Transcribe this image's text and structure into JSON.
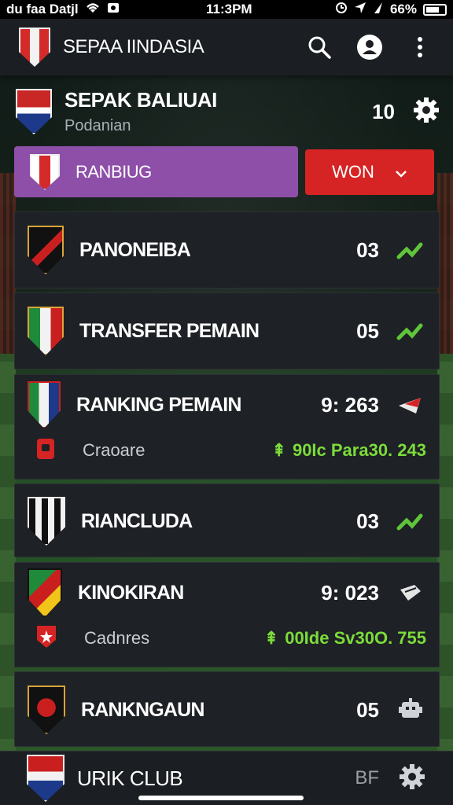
{
  "status_bar": {
    "carrier": "du faa Datjl",
    "time": "11:3PM",
    "battery": "66%"
  },
  "app_bar": {
    "title": "SEPAA IINDASIA",
    "icons": [
      "search-icon",
      "account-icon",
      "more-vert-icon"
    ]
  },
  "league": {
    "name": "SEPAK BALIUAI",
    "subtitle": "Podanian",
    "count": "10",
    "settings_icon": "gear-icon"
  },
  "filters": {
    "ranking_label": "RANBIUG",
    "won_label": "WON"
  },
  "cards": [
    {
      "title": "PANONEIBA",
      "value": "03",
      "trend": "up"
    },
    {
      "title": "TRANSFER PEMAIN",
      "value": "05",
      "trend": "up"
    },
    {
      "title": "RANKING PEMAIN",
      "value": "9: 263",
      "trend": "down",
      "sub": {
        "label": "Craoare",
        "value": "90Ic Para30.  243"
      }
    },
    {
      "title": "RIANCLUDA",
      "value": "03",
      "trend": "up"
    },
    {
      "title": "KINOKIRAN",
      "value": "9: 023",
      "trend": "flag",
      "sub": {
        "label": "Cadnres",
        "value": "00Ide Sv30O.  755"
      }
    },
    {
      "title": "RANKNGAUN",
      "value": "05",
      "trend": "robot"
    }
  ],
  "bottom_nav": {
    "title": "URIK CLUB",
    "code": "BF"
  },
  "colors": {
    "accent_purple": "#8e4fa8",
    "accent_red": "#d62424",
    "trend_green": "#5fc53a"
  }
}
